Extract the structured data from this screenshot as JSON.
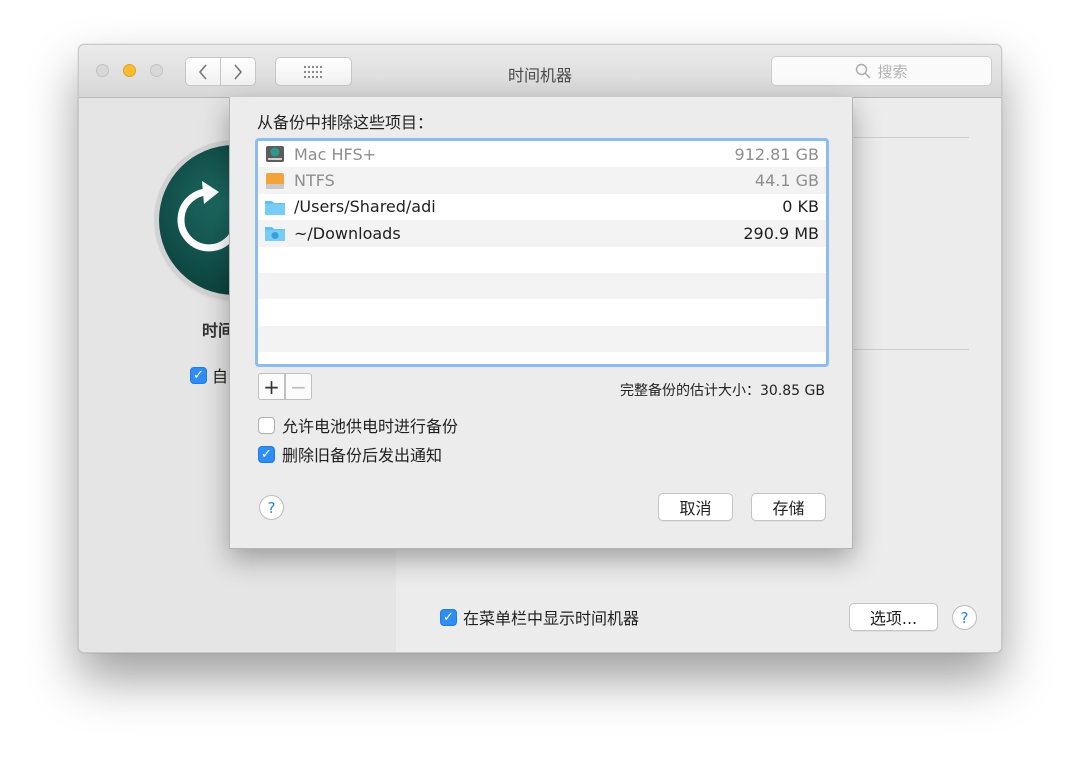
{
  "window": {
    "title": "时间机器",
    "search_placeholder": "搜索",
    "app_name": "时间机器",
    "auto_backup_label": "自动备份",
    "show_in_menubar_label": "在菜单栏中显示时间机器",
    "options_button": "选项...",
    "help_label": "?"
  },
  "sheet": {
    "title": "从备份中排除这些项目：",
    "items": [
      {
        "name": "Mac HFS+",
        "size": "912.81 GB",
        "icon": "hard-disk-icon",
        "dimmed": true
      },
      {
        "name": "NTFS",
        "size": "44.1 GB",
        "icon": "external-disk-icon",
        "dimmed": true
      },
      {
        "name": "/Users/Shared/adi",
        "size": "0 KB",
        "icon": "folder-icon",
        "dimmed": false
      },
      {
        "name": "~/Downloads",
        "size": "290.9 MB",
        "icon": "downloads-folder-icon",
        "dimmed": false
      }
    ],
    "add_label": "+",
    "remove_label": "−",
    "estimate": "完整备份的估计大小：30.85 GB",
    "battery_option": {
      "label": "允许电池供电时进行备份",
      "checked": false
    },
    "notify_option": {
      "label": "删除旧备份后发出通知",
      "checked": true
    },
    "help_label": "?",
    "cancel_button": "取消",
    "save_button": "存储"
  },
  "colors": {
    "accent": "#2f8ef4",
    "minimize": "#fcbc2f",
    "list_focus": "#8cbcf0"
  }
}
